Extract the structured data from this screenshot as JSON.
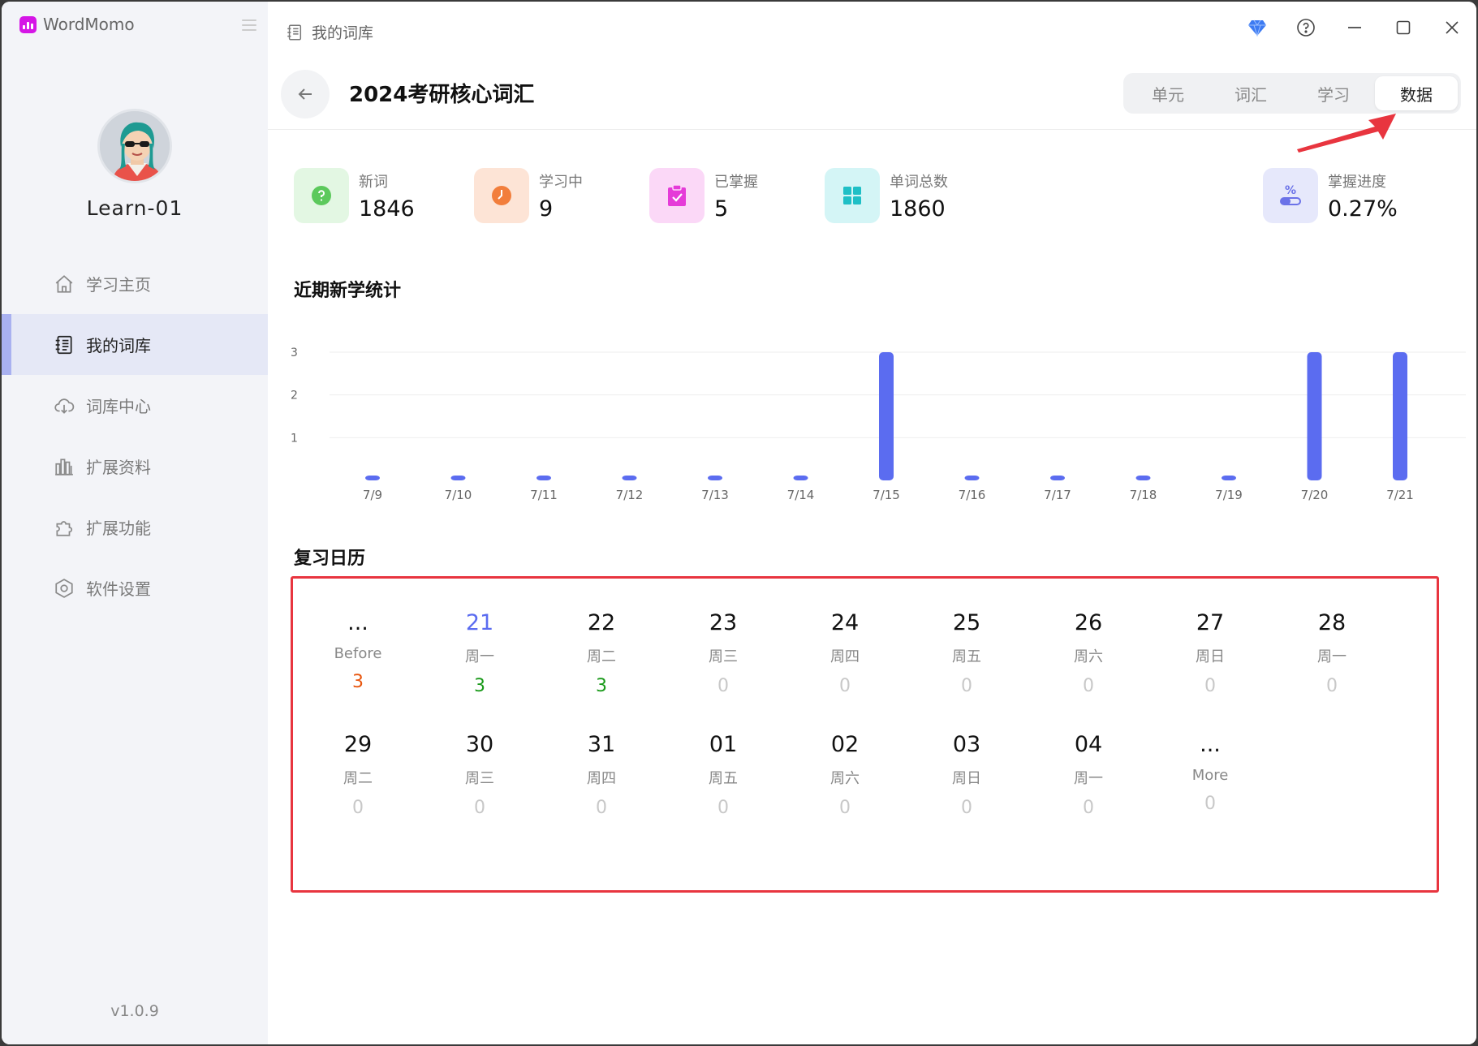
{
  "app": {
    "name": "WordMomo",
    "version": "v1.0.9"
  },
  "user": {
    "name": "Learn-01"
  },
  "nav": [
    {
      "label": "学习主页",
      "icon": "home-icon"
    },
    {
      "label": "我的词库",
      "icon": "notebook-icon",
      "active": true
    },
    {
      "label": "词库中心",
      "icon": "cloud-download-icon"
    },
    {
      "label": "扩展资料",
      "icon": "books-icon"
    },
    {
      "label": "扩展功能",
      "icon": "puzzle-icon"
    },
    {
      "label": "软件设置",
      "icon": "settings-hexagon-icon"
    }
  ],
  "header": {
    "breadcrumb": "我的词库",
    "title": "2024考研核心词汇"
  },
  "tabs": [
    {
      "label": "单元"
    },
    {
      "label": "词汇"
    },
    {
      "label": "学习"
    },
    {
      "label": "数据",
      "active": true
    }
  ],
  "stats": [
    {
      "label": "新词",
      "value": "1846",
      "color": "#5cc95c",
      "bg": "#e3f7e3",
      "icon": "question-icon"
    },
    {
      "label": "学习中",
      "value": "9",
      "color": "#f27e3c",
      "bg": "#fde4d6",
      "icon": "clock-icon"
    },
    {
      "label": "已掌握",
      "value": "5",
      "color": "#e53bd8",
      "bg": "#fbd8f7",
      "icon": "clipboard-check-icon"
    },
    {
      "label": "单词总数",
      "value": "1860",
      "color": "#1fbfc6",
      "bg": "#d4f5f6",
      "icon": "grid-icon"
    },
    {
      "label": "掌握进度",
      "value": "0.27%",
      "color": "#6b72e8",
      "bg": "#e6e8fb",
      "icon": "percent-icon"
    }
  ],
  "sections": {
    "chart_title": "近期新学统计",
    "calendar_title": "复习日历"
  },
  "chart_data": {
    "type": "bar",
    "categories": [
      "7/9",
      "7/10",
      "7/11",
      "7/12",
      "7/13",
      "7/14",
      "7/15",
      "7/16",
      "7/17",
      "7/18",
      "7/19",
      "7/20",
      "7/21"
    ],
    "values": [
      0,
      0,
      0,
      0,
      0,
      0,
      3,
      0,
      0,
      0,
      0,
      3,
      3
    ],
    "yticks": [
      1,
      2,
      3
    ],
    "ylim": [
      0,
      3
    ],
    "grid": true,
    "color": "#5b6cf0"
  },
  "calendar": [
    {
      "num": "...",
      "week": "Before",
      "count": "3",
      "tone": "red"
    },
    {
      "num": "21",
      "week": "周一",
      "count": "3",
      "tone": "green",
      "today": true
    },
    {
      "num": "22",
      "week": "周二",
      "count": "3",
      "tone": "green"
    },
    {
      "num": "23",
      "week": "周三",
      "count": "0"
    },
    {
      "num": "24",
      "week": "周四",
      "count": "0"
    },
    {
      "num": "25",
      "week": "周五",
      "count": "0"
    },
    {
      "num": "26",
      "week": "周六",
      "count": "0"
    },
    {
      "num": "27",
      "week": "周日",
      "count": "0"
    },
    {
      "num": "28",
      "week": "周一",
      "count": "0"
    },
    {
      "num": "29",
      "week": "周二",
      "count": "0"
    },
    {
      "num": "30",
      "week": "周三",
      "count": "0"
    },
    {
      "num": "31",
      "week": "周四",
      "count": "0"
    },
    {
      "num": "01",
      "week": "周五",
      "count": "0"
    },
    {
      "num": "02",
      "week": "周六",
      "count": "0"
    },
    {
      "num": "03",
      "week": "周日",
      "count": "0"
    },
    {
      "num": "04",
      "week": "周一",
      "count": "0"
    },
    {
      "num": "...",
      "week": "More",
      "count": "0"
    }
  ]
}
